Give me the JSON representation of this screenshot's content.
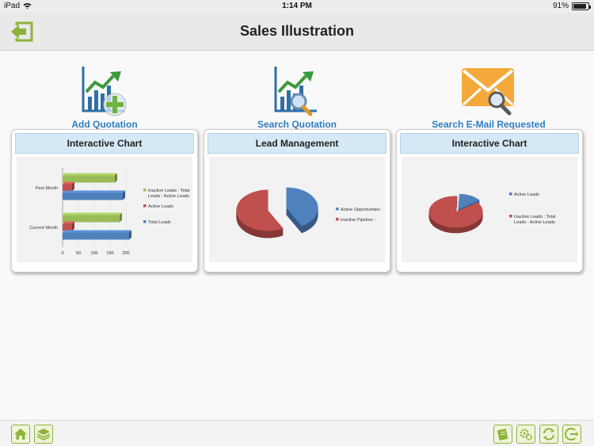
{
  "status_bar": {
    "carrier": "iPad",
    "time": "1:14 PM",
    "battery": "91%",
    "battery_level": 0.91
  },
  "nav": {
    "title": "Sales Illustration",
    "back_icon": "back-arrow-icon"
  },
  "actions": [
    {
      "label": "Add Quotation",
      "icon": "chart-add-icon"
    },
    {
      "label": "Search Quotation",
      "icon": "chart-search-icon"
    },
    {
      "label": "Search E-Mail Requested",
      "icon": "envelope-search-icon"
    }
  ],
  "cards": [
    {
      "title": "Interactive Chart",
      "chart_data": {
        "type": "bar",
        "orientation": "horizontal",
        "categories": [
          "Current Month",
          "Past Month"
        ],
        "series": [
          {
            "name": "Total Leads",
            "color": "#4f81bd",
            "values": [
              210,
              190
            ]
          },
          {
            "name": "Active Leads",
            "color": "#c0504d",
            "values": [
              30,
              30
            ]
          },
          {
            "name": "Inactive Leads : Total Leads - Active Leads",
            "color": "#9bbb59",
            "values": [
              180,
              165
            ]
          }
        ],
        "x_ticks": [
          "0",
          "50",
          "100",
          "150",
          "200"
        ],
        "xlim": [
          0,
          200
        ],
        "legend": "right"
      }
    },
    {
      "title": "Lead Management",
      "chart_data": {
        "type": "pie",
        "style": "3d-exploded",
        "labels": [
          "Active Opportunities",
          "Inactive Pipeline :"
        ],
        "values": [
          42,
          58
        ],
        "colors": [
          "#4f81bd",
          "#c0504d"
        ],
        "legend": "right"
      }
    },
    {
      "title": "Interactive Chart",
      "chart_data": {
        "type": "pie",
        "style": "3d",
        "labels": [
          "Active Leads",
          "Inactive Leads : Total Leads - Active Leads"
        ],
        "values": [
          14,
          86
        ],
        "colors": [
          "#4f81bd",
          "#c0504d"
        ],
        "legend": "right"
      }
    }
  ],
  "toolbar": {
    "left": [
      {
        "icon": "home-icon"
      },
      {
        "icon": "layers-icon"
      }
    ],
    "right": [
      {
        "icon": "notes-icon"
      },
      {
        "icon": "settings-icon"
      },
      {
        "icon": "sync-icon"
      },
      {
        "icon": "logout-icon"
      }
    ],
    "accent": "#8db33a"
  }
}
